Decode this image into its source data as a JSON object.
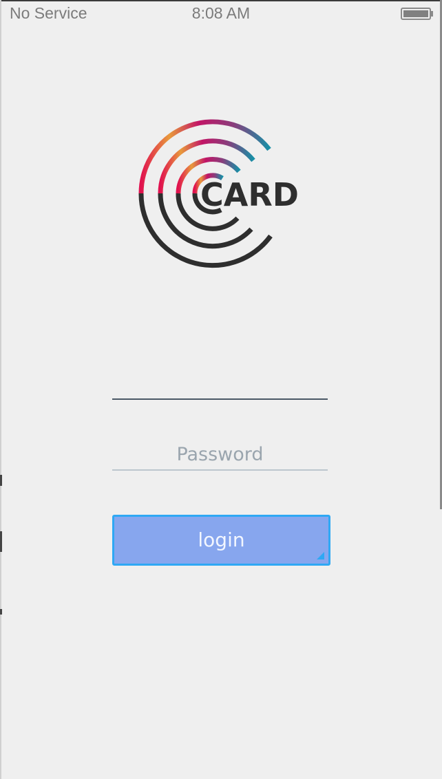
{
  "status_bar": {
    "carrier": "No Service",
    "time": "8:08 AM",
    "battery_icon": "battery-full-icon"
  },
  "logo": {
    "text": "CARD",
    "colors": {
      "gradient": [
        "#e89a3c",
        "#e0124f",
        "#c21566",
        "#8a3d7c",
        "#178fa6"
      ],
      "dark": "#2e2e2e"
    }
  },
  "login_form": {
    "username": {
      "value": "",
      "placeholder": ""
    },
    "password": {
      "value": "",
      "placeholder": "Password"
    },
    "login_label": "login"
  },
  "colors": {
    "background": "#efefef",
    "button_fill": "#87a6ee",
    "button_border": "#2ea8f4",
    "field_underline_active": "#4a5865",
    "field_underline": "#bcc6cd"
  }
}
